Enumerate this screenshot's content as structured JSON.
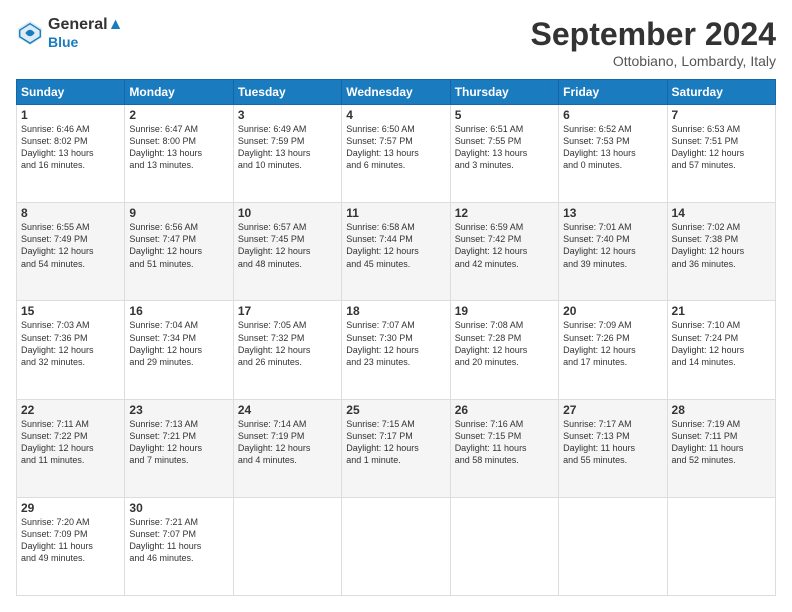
{
  "logo": {
    "line1": "General",
    "line2": "Blue"
  },
  "title": "September 2024",
  "location": "Ottobiano, Lombardy, Italy",
  "days_of_week": [
    "Sunday",
    "Monday",
    "Tuesday",
    "Wednesday",
    "Thursday",
    "Friday",
    "Saturday"
  ],
  "weeks": [
    [
      {
        "day": 1,
        "lines": [
          "Sunrise: 6:46 AM",
          "Sunset: 8:02 PM",
          "Daylight: 13 hours",
          "and 16 minutes."
        ]
      },
      {
        "day": 2,
        "lines": [
          "Sunrise: 6:47 AM",
          "Sunset: 8:00 PM",
          "Daylight: 13 hours",
          "and 13 minutes."
        ]
      },
      {
        "day": 3,
        "lines": [
          "Sunrise: 6:49 AM",
          "Sunset: 7:59 PM",
          "Daylight: 13 hours",
          "and 10 minutes."
        ]
      },
      {
        "day": 4,
        "lines": [
          "Sunrise: 6:50 AM",
          "Sunset: 7:57 PM",
          "Daylight: 13 hours",
          "and 6 minutes."
        ]
      },
      {
        "day": 5,
        "lines": [
          "Sunrise: 6:51 AM",
          "Sunset: 7:55 PM",
          "Daylight: 13 hours",
          "and 3 minutes."
        ]
      },
      {
        "day": 6,
        "lines": [
          "Sunrise: 6:52 AM",
          "Sunset: 7:53 PM",
          "Daylight: 13 hours",
          "and 0 minutes."
        ]
      },
      {
        "day": 7,
        "lines": [
          "Sunrise: 6:53 AM",
          "Sunset: 7:51 PM",
          "Daylight: 12 hours",
          "and 57 minutes."
        ]
      }
    ],
    [
      {
        "day": 8,
        "lines": [
          "Sunrise: 6:55 AM",
          "Sunset: 7:49 PM",
          "Daylight: 12 hours",
          "and 54 minutes."
        ]
      },
      {
        "day": 9,
        "lines": [
          "Sunrise: 6:56 AM",
          "Sunset: 7:47 PM",
          "Daylight: 12 hours",
          "and 51 minutes."
        ]
      },
      {
        "day": 10,
        "lines": [
          "Sunrise: 6:57 AM",
          "Sunset: 7:45 PM",
          "Daylight: 12 hours",
          "and 48 minutes."
        ]
      },
      {
        "day": 11,
        "lines": [
          "Sunrise: 6:58 AM",
          "Sunset: 7:44 PM",
          "Daylight: 12 hours",
          "and 45 minutes."
        ]
      },
      {
        "day": 12,
        "lines": [
          "Sunrise: 6:59 AM",
          "Sunset: 7:42 PM",
          "Daylight: 12 hours",
          "and 42 minutes."
        ]
      },
      {
        "day": 13,
        "lines": [
          "Sunrise: 7:01 AM",
          "Sunset: 7:40 PM",
          "Daylight: 12 hours",
          "and 39 minutes."
        ]
      },
      {
        "day": 14,
        "lines": [
          "Sunrise: 7:02 AM",
          "Sunset: 7:38 PM",
          "Daylight: 12 hours",
          "and 36 minutes."
        ]
      }
    ],
    [
      {
        "day": 15,
        "lines": [
          "Sunrise: 7:03 AM",
          "Sunset: 7:36 PM",
          "Daylight: 12 hours",
          "and 32 minutes."
        ]
      },
      {
        "day": 16,
        "lines": [
          "Sunrise: 7:04 AM",
          "Sunset: 7:34 PM",
          "Daylight: 12 hours",
          "and 29 minutes."
        ]
      },
      {
        "day": 17,
        "lines": [
          "Sunrise: 7:05 AM",
          "Sunset: 7:32 PM",
          "Daylight: 12 hours",
          "and 26 minutes."
        ]
      },
      {
        "day": 18,
        "lines": [
          "Sunrise: 7:07 AM",
          "Sunset: 7:30 PM",
          "Daylight: 12 hours",
          "and 23 minutes."
        ]
      },
      {
        "day": 19,
        "lines": [
          "Sunrise: 7:08 AM",
          "Sunset: 7:28 PM",
          "Daylight: 12 hours",
          "and 20 minutes."
        ]
      },
      {
        "day": 20,
        "lines": [
          "Sunrise: 7:09 AM",
          "Sunset: 7:26 PM",
          "Daylight: 12 hours",
          "and 17 minutes."
        ]
      },
      {
        "day": 21,
        "lines": [
          "Sunrise: 7:10 AM",
          "Sunset: 7:24 PM",
          "Daylight: 12 hours",
          "and 14 minutes."
        ]
      }
    ],
    [
      {
        "day": 22,
        "lines": [
          "Sunrise: 7:11 AM",
          "Sunset: 7:22 PM",
          "Daylight: 12 hours",
          "and 11 minutes."
        ]
      },
      {
        "day": 23,
        "lines": [
          "Sunrise: 7:13 AM",
          "Sunset: 7:21 PM",
          "Daylight: 12 hours",
          "and 7 minutes."
        ]
      },
      {
        "day": 24,
        "lines": [
          "Sunrise: 7:14 AM",
          "Sunset: 7:19 PM",
          "Daylight: 12 hours",
          "and 4 minutes."
        ]
      },
      {
        "day": 25,
        "lines": [
          "Sunrise: 7:15 AM",
          "Sunset: 7:17 PM",
          "Daylight: 12 hours",
          "and 1 minute."
        ]
      },
      {
        "day": 26,
        "lines": [
          "Sunrise: 7:16 AM",
          "Sunset: 7:15 PM",
          "Daylight: 11 hours",
          "and 58 minutes."
        ]
      },
      {
        "day": 27,
        "lines": [
          "Sunrise: 7:17 AM",
          "Sunset: 7:13 PM",
          "Daylight: 11 hours",
          "and 55 minutes."
        ]
      },
      {
        "day": 28,
        "lines": [
          "Sunrise: 7:19 AM",
          "Sunset: 7:11 PM",
          "Daylight: 11 hours",
          "and 52 minutes."
        ]
      }
    ],
    [
      {
        "day": 29,
        "lines": [
          "Sunrise: 7:20 AM",
          "Sunset: 7:09 PM",
          "Daylight: 11 hours",
          "and 49 minutes."
        ]
      },
      {
        "day": 30,
        "lines": [
          "Sunrise: 7:21 AM",
          "Sunset: 7:07 PM",
          "Daylight: 11 hours",
          "and 46 minutes."
        ]
      },
      {
        "day": null,
        "lines": []
      },
      {
        "day": null,
        "lines": []
      },
      {
        "day": null,
        "lines": []
      },
      {
        "day": null,
        "lines": []
      },
      {
        "day": null,
        "lines": []
      }
    ]
  ]
}
